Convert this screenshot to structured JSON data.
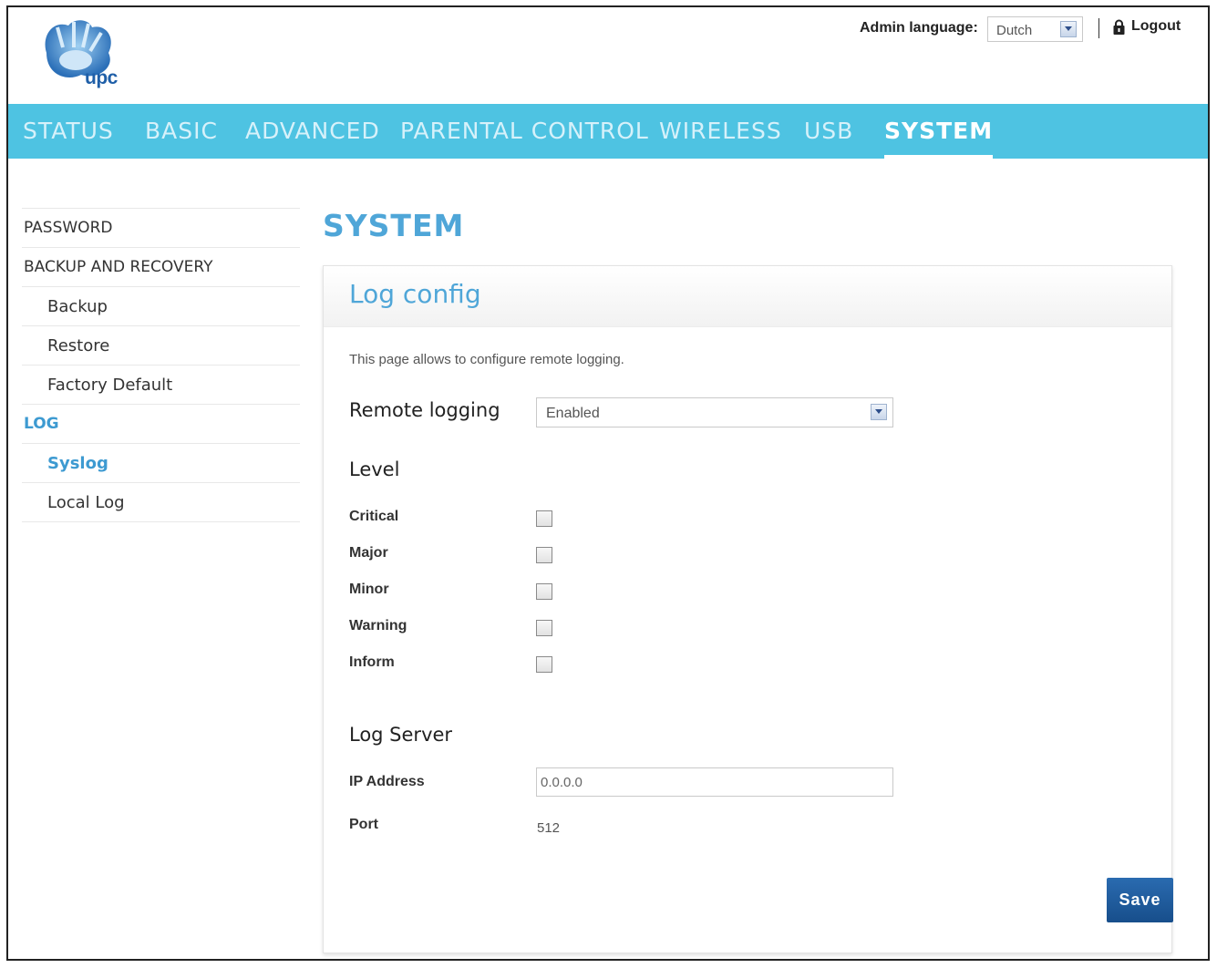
{
  "header": {
    "logo_text": "upc",
    "admin_language_label": "Admin language:",
    "admin_language_value": "Dutch",
    "logout_label": "Logout"
  },
  "nav": {
    "items": [
      {
        "label": "STATUS"
      },
      {
        "label": "BASIC"
      },
      {
        "label": "ADVANCED"
      },
      {
        "label": "PARENTAL CONTROL"
      },
      {
        "label": "WIRELESS"
      },
      {
        "label": "USB"
      },
      {
        "label": "SYSTEM",
        "active": true
      }
    ]
  },
  "sidebar": {
    "items": [
      {
        "label": "PASSWORD"
      },
      {
        "label": "BACKUP AND RECOVERY"
      },
      {
        "label": "Backup"
      },
      {
        "label": "Restore"
      },
      {
        "label": "Factory Default"
      },
      {
        "label": "LOG"
      },
      {
        "label": "Syslog",
        "current": true
      },
      {
        "label": "Local Log"
      }
    ]
  },
  "main": {
    "page_title": "SYSTEM",
    "panel_title": "Log config",
    "description": "This page allows to configure remote logging.",
    "remote_logging": {
      "label": "Remote logging",
      "value": "Enabled"
    },
    "level": {
      "heading": "Level",
      "options": [
        {
          "label": "Critical",
          "checked": false
        },
        {
          "label": "Major",
          "checked": false
        },
        {
          "label": "Minor",
          "checked": false
        },
        {
          "label": "Warning",
          "checked": false
        },
        {
          "label": "Inform",
          "checked": false
        }
      ]
    },
    "log_server": {
      "heading": "Log Server",
      "ip_label": "IP Address",
      "ip_value": "0.0.0.0",
      "port_label": "Port",
      "port_value": "512"
    },
    "save_label": "Save"
  },
  "colors": {
    "nav_bg": "#4ec3e2",
    "accent": "#4fa6d8",
    "save_button": "#1f5c9e"
  }
}
